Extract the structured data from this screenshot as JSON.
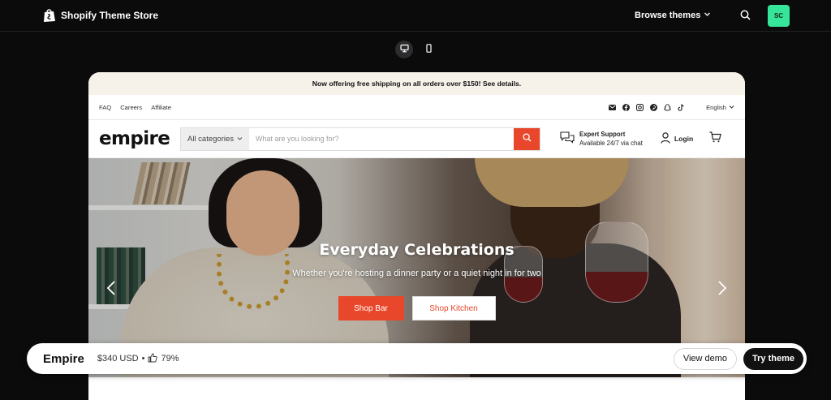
{
  "store": {
    "brand": "Shopify Theme Store",
    "browse_label": "Browse themes",
    "avatar_initials": "SC",
    "avatar_color": "#36e59a"
  },
  "device_toggle": {
    "desktop_icon": "desktop-icon",
    "mobile_icon": "mobile-icon",
    "active": "desktop"
  },
  "preview": {
    "announcement": "Now offering free shipping on all orders over $150! See details.",
    "util_links": [
      "FAQ",
      "Careers",
      "Affiliate"
    ],
    "social_icons": [
      "mail-icon",
      "facebook-icon",
      "instagram-icon",
      "pinterest-icon",
      "snapchat-icon",
      "tiktok-icon"
    ],
    "language": "English",
    "logo": "empire",
    "search": {
      "category": "All categories",
      "placeholder": "What are you looking for?"
    },
    "support": {
      "title": "Expert Support",
      "subtitle": "Available 24/7 via chat"
    },
    "login_label": "Login",
    "accent_color": "#e8472b",
    "hero": {
      "title": "Everyday Celebrations",
      "subtitle": "Whether you're hosting a dinner party or a quiet night in for two",
      "primary_button": "Shop Bar",
      "secondary_button": "Shop Kitchen"
    }
  },
  "theme_bar": {
    "name": "Empire",
    "price": "$340 USD",
    "rating": "79%",
    "demo_button": "View demo",
    "try_button": "Try theme"
  }
}
